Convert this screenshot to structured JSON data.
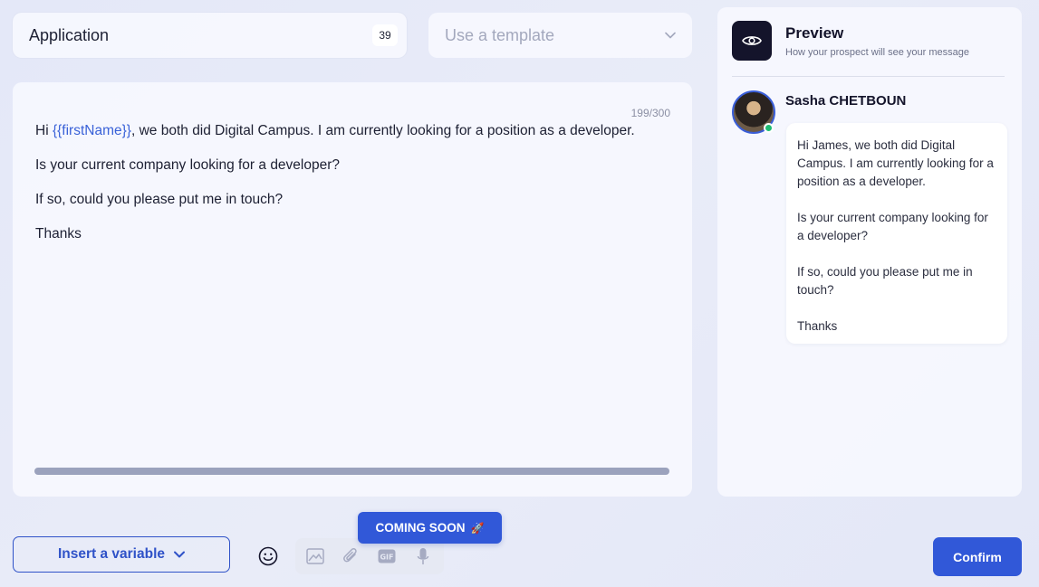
{
  "name_field": {
    "value": "Application",
    "count": "39"
  },
  "template_select": {
    "placeholder": "Use a template"
  },
  "editor": {
    "char_count": "199/300",
    "line1_prefix": "Hi ",
    "line1_variable": "{{firstName}}",
    "line1_suffix": ", we both did Digital Campus. I am currently looking for a position as a developer.",
    "line2": "Is your current company looking for a developer?",
    "line3": "If so, could you please put me in touch?",
    "line4": "Thanks"
  },
  "preview": {
    "title": "Preview",
    "subtitle": "How your prospect will see your message",
    "sender_name": "Sasha CHETBOUN",
    "message": {
      "p1": "Hi James, we both did Digital Campus. I am currently looking for a position as a developer.",
      "p2": "Is your current company looking for a developer?",
      "p3": "If so, could you please put me in touch?",
      "p4": "Thanks"
    }
  },
  "toolbar": {
    "insert_variable_label": "Insert a variable",
    "coming_soon_label": "COMING SOON",
    "coming_soon_emoji": "🚀",
    "gif_label": "GIF",
    "confirm_label": "Confirm"
  },
  "colors": {
    "accent": "#3158d8",
    "dark": "#14142b",
    "variable": "#3a62d8",
    "online": "#1ebc73"
  }
}
